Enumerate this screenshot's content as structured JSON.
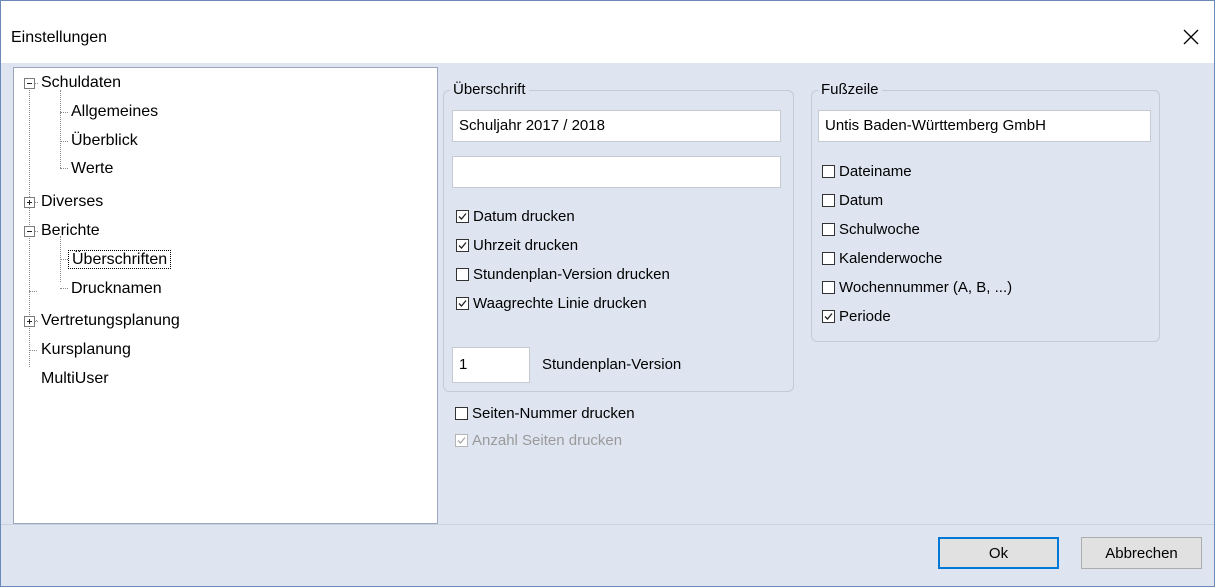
{
  "window": {
    "title": "Einstellungen"
  },
  "tree": {
    "schuldaten": "Schuldaten",
    "allgemeines": "Allgemeines",
    "ueberblick": "Überblick",
    "werte": "Werte",
    "diverses": "Diverses",
    "berichte": "Berichte",
    "ueberschriften": "Überschriften",
    "drucknamen": "Drucknamen",
    "vertretungsplanung": "Vertretungsplanung",
    "kursplanung": "Kursplanung",
    "multiuser": "MultiUser"
  },
  "header_group": {
    "title": "Überschrift",
    "line1": "Schuljahr 2017 / 2018",
    "line2": "",
    "options": [
      {
        "label": "Datum drucken",
        "checked": true
      },
      {
        "label": "Uhrzeit drucken",
        "checked": true
      },
      {
        "label": "Stundenplan-Version drucken",
        "checked": false
      },
      {
        "label": "Waagrechte Linie drucken",
        "checked": true
      }
    ],
    "version_value": "1",
    "version_label": "Stundenplan-Version"
  },
  "page_options": [
    {
      "label": "Seiten-Nummer drucken",
      "checked": false,
      "disabled": false
    },
    {
      "label": "Anzahl Seiten drucken",
      "checked": true,
      "disabled": true
    }
  ],
  "footer_group": {
    "title": "Fußzeile",
    "text": "Untis Baden-Württemberg GmbH",
    "options": [
      {
        "label": "Dateiname",
        "checked": false
      },
      {
        "label": "Datum",
        "checked": false
      },
      {
        "label": "Schulwoche",
        "checked": false
      },
      {
        "label": "Kalenderwoche",
        "checked": false
      },
      {
        "label": "Wochennummer (A, B, ...)",
        "checked": false
      },
      {
        "label": "Periode",
        "checked": true
      }
    ]
  },
  "buttons": {
    "ok": "Ok",
    "cancel": "Abbrechen"
  },
  "colors": {
    "client_bg": "#dee5f1",
    "accent": "#0078d7"
  }
}
